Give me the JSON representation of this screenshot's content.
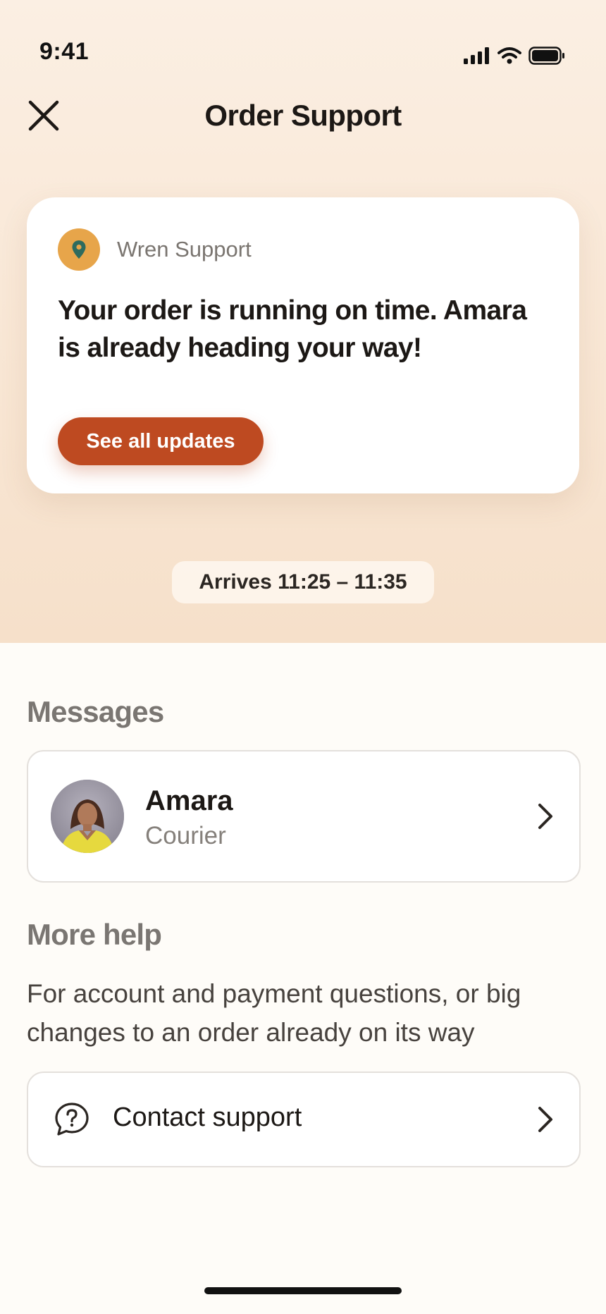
{
  "status_bar": {
    "time": "9:41",
    "icons": [
      "cellular-signal-icon",
      "wifi-icon",
      "battery-icon"
    ]
  },
  "header": {
    "title": "Order Support",
    "close_icon": "close-icon"
  },
  "update_card": {
    "sender": "Wren Support",
    "sender_icon": "location-pin-icon",
    "message": "Your order is running on time. Amara is already heading your way!",
    "button_label": "See all updates"
  },
  "eta": {
    "label": "Arrives 11:25 – 11:35"
  },
  "messages": {
    "title": "Messages",
    "thread": {
      "name": "Amara",
      "role": "Courier"
    }
  },
  "more_help": {
    "title": "More help",
    "description": "For account and payment questions, or big changes to an order already on its way",
    "contact_label": "Contact support",
    "contact_icon": "question-chat-icon"
  },
  "colors": {
    "accent": "#BE4A21",
    "pin_badge": "#E7A54A",
    "pin_fill": "#2E6B5E",
    "top_background": "#F9E8D7",
    "page_background": "#FEFCF8"
  }
}
